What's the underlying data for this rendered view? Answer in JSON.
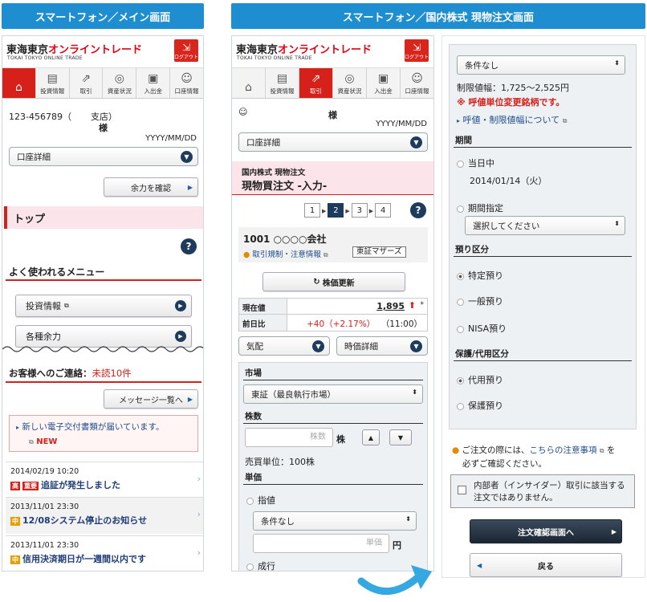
{
  "headers": {
    "left": "スマートフォン／メイン画面",
    "right": "スマートフォン／国内株式 現物注文画面"
  },
  "brand": {
    "name1": "東海東京",
    "name2": "オンライントレード",
    "sub": "TOKAI TOKYO ONLINE TRADE",
    "logout": "ログアウト"
  },
  "nav": {
    "home": "",
    "invest": "投資情報",
    "trade": "取引",
    "assets": "資産状況",
    "inout": "入出金",
    "account": "口座情報"
  },
  "main": {
    "account_no": "123-456789（",
    "branch": "支店）",
    "sama": "様",
    "date": "YYYY/MM/DD",
    "select_account": "口座詳細",
    "check_balance": "余力を確認",
    "top_title": "トップ",
    "help": "?",
    "menu_title": "よく使われるメニュー",
    "menu_items": [
      "投資情報",
      "各種余力"
    ],
    "contact_label": "お客様へのご連絡：",
    "contact_unread": "未読10件",
    "msg_list_btn": "メッセージ一覧へ",
    "new_doc": "新しい電子交付書類が届いています。",
    "new_badge": "NEW",
    "notices": [
      {
        "date": "2014/02/19 10:20",
        "tags": [
          "高",
          "重要"
        ],
        "text": "追証が発生しました"
      },
      {
        "date": "2013/11/01 23:30",
        "tags": [
          "中"
        ],
        "text": "12/08システム停止のお知らせ"
      },
      {
        "date": "2013/11/01 23:30",
        "tags": [
          "中"
        ],
        "text": "信用決済期日が一週間以内です"
      }
    ]
  },
  "order": {
    "sama": "様",
    "date": "YYYY/MM/DD",
    "select_account": "口座詳細",
    "crumb": "国内株式 現物注文",
    "title": "現物買注文 -入力-",
    "steps": [
      "1",
      "2",
      "3",
      "4"
    ],
    "stock": "1001 ○○○○会社",
    "restrict": "取引規制・注意情報",
    "market_badge": "東証マザーズ",
    "refresh": "株価更新",
    "price_label": "現在値",
    "price": "1,895",
    "price_mark": "*",
    "prev_label": "前日比",
    "change": "+40（+2.17%）",
    "time": "（11:00）",
    "sel_quote": "気配",
    "sel_time": "時価詳細",
    "market_label": "市場",
    "market_value": "東証（最良執行市場）",
    "qty_label": "株数",
    "qty_placeholder": "株数",
    "qty_unit": "株",
    "unit_info": "売買単位：100株",
    "price_section": "単価",
    "limit": "指値",
    "cond": "条件なし",
    "price_placeholder": "単価",
    "yen": "円",
    "market_order": "成行"
  },
  "cont": {
    "cond": "条件なし",
    "range": "制限値幅：1,725～2,525円",
    "warn": "※ 呼値単位変更銘柄です。",
    "link": "呼値・制限値幅について",
    "period": "期間",
    "today": "当日中",
    "today_date": "2014/01/14（火）",
    "period_specify": "期間指定",
    "choose": "選択してください",
    "deposit": "預り区分",
    "dep_opts": [
      "特定預り",
      "一般預り",
      "NISA預り"
    ],
    "collat": "保護/代用区分",
    "col_opts": [
      "代用預り",
      "保護預り"
    ],
    "caution1": "ご注文の際には、",
    "caution_link": "こちらの注意事項",
    "caution2": "を",
    "caution3": "必ずご確認ください。",
    "insider": "内部者（インサイダー）取引に該当する注文ではありません。",
    "confirm": "注文確認画面へ",
    "back": "戻る"
  }
}
